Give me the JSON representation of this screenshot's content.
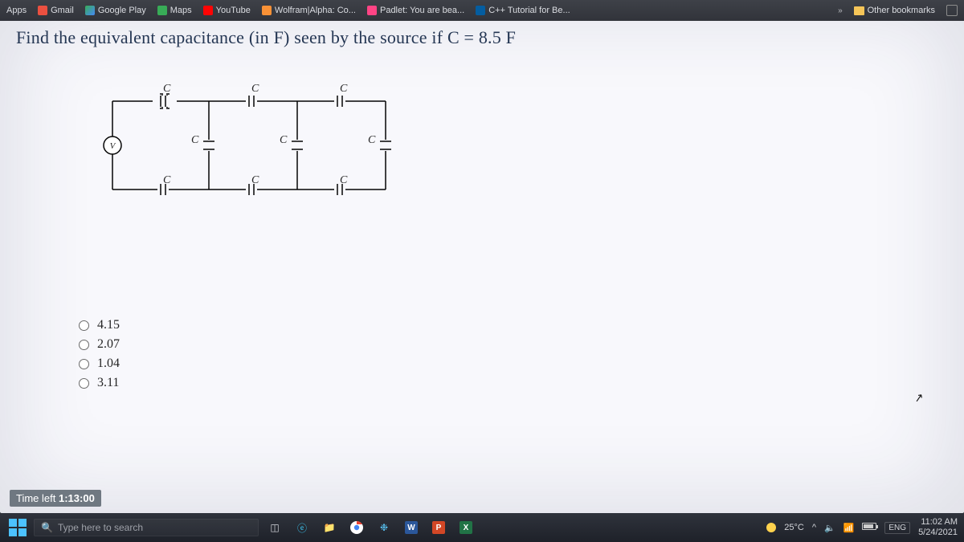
{
  "bookmarks": {
    "items": [
      {
        "label": "Apps"
      },
      {
        "label": "Gmail"
      },
      {
        "label": "Google Play"
      },
      {
        "label": "Maps"
      },
      {
        "label": "YouTube"
      },
      {
        "label": "Wolfram|Alpha: Co..."
      },
      {
        "label": "Padlet: You are bea..."
      },
      {
        "label": "C++ Tutorial for Be..."
      }
    ],
    "overflow": "»",
    "other": "Other bookmarks"
  },
  "question": "Find the equivalent capacitance (in F) seen by the source if C = 8.5 F",
  "circuit_labels": {
    "src": "V",
    "c": "C"
  },
  "options": [
    "4.15",
    "2.07",
    "1.04",
    "3.11"
  ],
  "timer": {
    "prefix": "Time left ",
    "value": "1:13:00"
  },
  "taskbar": {
    "search_placeholder": "Type here to search",
    "weather_temp": "25°C",
    "lang": "ENG",
    "time": "11:02 AM",
    "date": "5/24/2021"
  }
}
